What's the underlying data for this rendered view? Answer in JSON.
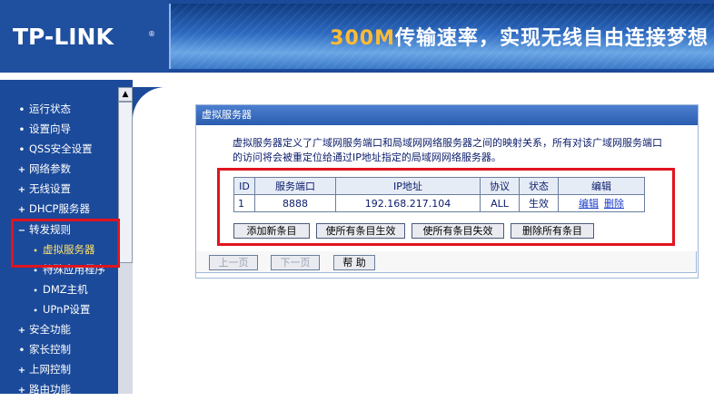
{
  "header": {
    "logo": "TP-LINK",
    "logo_mark": "®",
    "banner_num": "300M",
    "banner_text": "传输速率，实现无线自由连接梦想"
  },
  "sidebar": {
    "items": [
      {
        "label": "运行状态",
        "bullet": "•"
      },
      {
        "label": "设置向导",
        "bullet": "•"
      },
      {
        "label": "QSS安全设置",
        "bullet": "•"
      },
      {
        "label": "网络参数",
        "bullet": "+"
      },
      {
        "label": "无线设置",
        "bullet": "+"
      },
      {
        "label": "DHCP服务器",
        "bullet": "+"
      },
      {
        "label": "转发规则",
        "bullet": "−"
      },
      {
        "label": "虚拟服务器",
        "bullet": "•"
      },
      {
        "label": "特殊应用程序",
        "bullet": "•"
      },
      {
        "label": "DMZ主机",
        "bullet": "•"
      },
      {
        "label": "UPnP设置",
        "bullet": "•"
      },
      {
        "label": "安全功能",
        "bullet": "+"
      },
      {
        "label": "家长控制",
        "bullet": "•"
      },
      {
        "label": "上网控制",
        "bullet": "+"
      },
      {
        "label": "路由功能",
        "bullet": "+"
      }
    ],
    "scroll_up": "▲"
  },
  "panel": {
    "title": "虚拟服务器",
    "description": "虚拟服务器定义了广域网服务端口和局域网网络服务器之间的映射关系，所有对该广域网服务端口的访问将会被重定位给通过IP地址指定的局域网网络服务器。"
  },
  "table": {
    "headers": [
      "ID",
      "服务端口",
      "IP地址",
      "协议",
      "状态",
      "编辑"
    ],
    "rows": [
      {
        "id": "1",
        "port": "8888",
        "ip": "192.168.217.104",
        "protocol": "ALL",
        "status": "生效",
        "edit": "编辑",
        "delete": "删除"
      }
    ]
  },
  "buttons": {
    "add": "添加新条目",
    "enable_all": "使所有条目生效",
    "disable_all": "使所有条目失效",
    "delete_all": "删除所有条目"
  },
  "nav": {
    "prev": "上一页",
    "next": "下一页",
    "help": "帮 助"
  }
}
